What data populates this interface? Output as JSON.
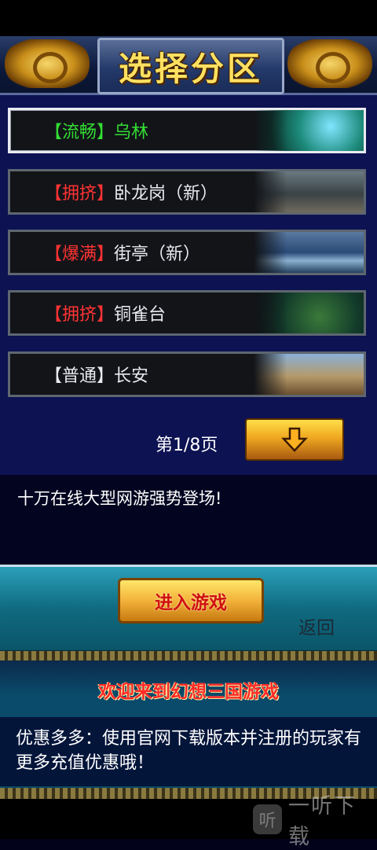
{
  "header": {
    "title": "选择分区"
  },
  "servers": [
    {
      "status": "【流畅】",
      "status_color": "#33dd33",
      "name": "乌林",
      "name_color": "#33dd33",
      "selected": true,
      "thumb": "forest-waterfall"
    },
    {
      "status": "【拥挤】",
      "status_color": "#ff3333",
      "name": "卧龙岗（新）",
      "name_color": "#e8eaf0",
      "selected": false,
      "thumb": "rocky-cave"
    },
    {
      "status": "【爆满】",
      "status_color": "#ff3333",
      "name": "街亭（新）",
      "name_color": "#e8eaf0",
      "selected": false,
      "thumb": "mountain-river"
    },
    {
      "status": "【拥挤】",
      "status_color": "#ff3333",
      "name": "铜雀台",
      "name_color": "#e8eaf0",
      "selected": false,
      "thumb": "jungle"
    },
    {
      "status": "【普通】",
      "status_color": "#e8eaf0",
      "name": "长安",
      "name_color": "#e8eaf0",
      "selected": false,
      "thumb": "battlefield"
    }
  ],
  "pager": {
    "label": "第1/8页",
    "next_icon": "arrow-down-icon"
  },
  "description": "十万在线大型网游强势登场!",
  "actions": {
    "enter_label": "进入游戏",
    "back_label": "返回"
  },
  "welcome": "欢迎来到幻想三国游戏",
  "promo": "优惠多多：使用官网下载版本并注册的玩家有更多充值优惠哦！",
  "watermark": {
    "logo_glyph": "听",
    "text": "一听下载"
  }
}
